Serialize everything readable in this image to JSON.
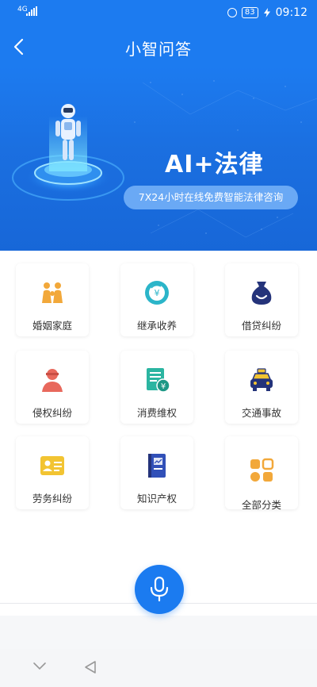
{
  "status_bar": {
    "signal_small": "4G",
    "battery": "83",
    "time": "09:12",
    "icons": [
      "signal-icon",
      "alarm-icon",
      "battery-icon",
      "charging-icon"
    ]
  },
  "header": {
    "title": "小智问答",
    "back_icon": "chevron-left-icon"
  },
  "banner": {
    "headline": "AI+法律",
    "tagline": "7X24小时在线免费智能法律咨询"
  },
  "categories": [
    {
      "label": "婚姻家庭",
      "icon": "family-icon"
    },
    {
      "label": "继承收养",
      "icon": "inheritance-icon"
    },
    {
      "label": "借贷纠纷",
      "icon": "money-bag-icon"
    },
    {
      "label": "侵权纠纷",
      "icon": "person-icon"
    },
    {
      "label": "消费维权",
      "icon": "receipt-icon"
    },
    {
      "label": "交通事故",
      "icon": "taxi-icon"
    },
    {
      "label": "劳务纠纷",
      "icon": "id-card-icon"
    },
    {
      "label": "知识产权",
      "icon": "book-icon"
    },
    {
      "label": "全部分类",
      "icon": "grid-icon"
    }
  ],
  "voice": {
    "icon": "microphone-icon"
  },
  "nav": {
    "icons": [
      "chevron-down-icon",
      "triangle-back-icon"
    ]
  },
  "colors": {
    "primary": "#1c7bf0",
    "orange": "#f2a83a",
    "red": "#e8685c",
    "teal": "#2bb5a1",
    "navy": "#24337a",
    "yellow": "#f2c432"
  }
}
